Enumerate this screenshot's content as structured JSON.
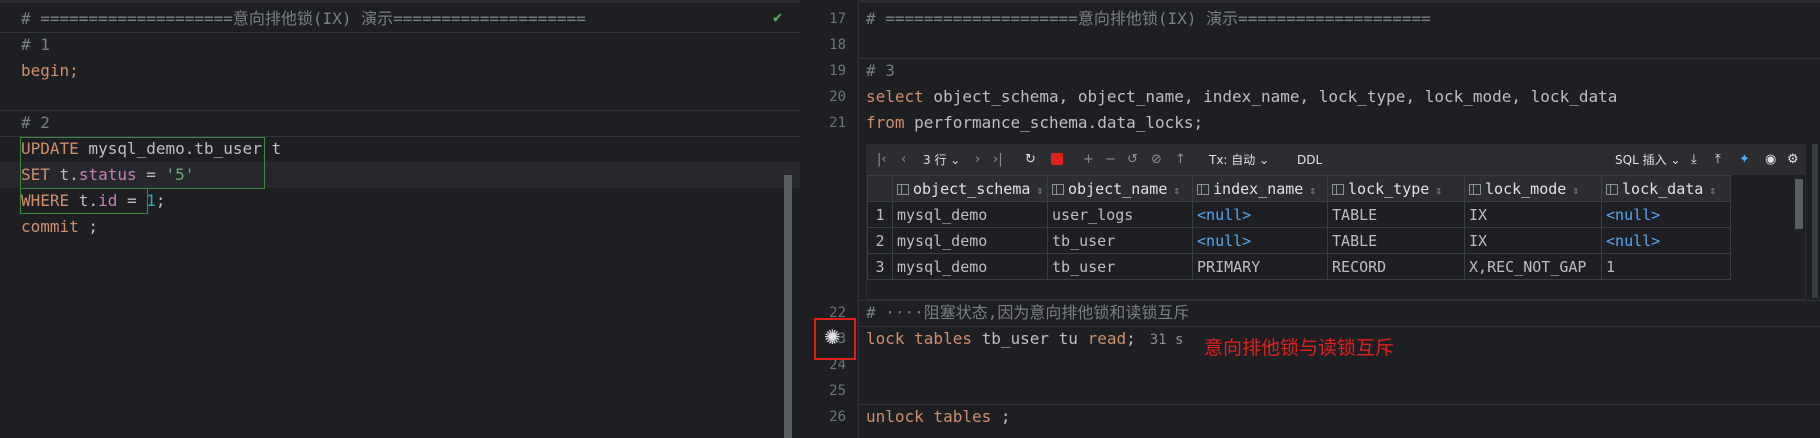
{
  "left": {
    "lines": {
      "l1": "# ====================意向排他锁(IX) 演示====================",
      "l2": "# 1",
      "l3": "begin;",
      "l5": "# 2",
      "l6_kw": "UPDATE",
      "l6_rest": " mysql_demo.tb_user t",
      "l7_kw": "SET",
      "l7_a": " t.",
      "l7_fld": "status",
      "l7_b": " = ",
      "l7_str": "'5'",
      "l8_kw": "WHERE",
      "l8_a": " t.",
      "l8_fld": "id",
      "l8_b": " = ",
      "l8_num": "1",
      "l8_c": ";",
      "l9_kw": "commit",
      "l9_rest": " ;"
    },
    "ok_icon": "check-icon",
    "close_icon": "×"
  },
  "right": {
    "line_numbers": {
      "n17": "17",
      "n18": "18",
      "n19": "19",
      "n20": "20",
      "n21": "21",
      "n22": "22",
      "n23": "23",
      "n24": "24",
      "n25": "25",
      "n26": "26"
    },
    "lines": {
      "l17": "# ====================意向排他锁(IX) 演示====================",
      "l19": "# 3",
      "l20_kw": "select",
      "l20_rest": " object_schema, object_name, index_name, lock_type, lock_mode, lock_data",
      "l21_kw": "from",
      "l21_rest": " performance_schema.data_locks;",
      "l22": "# ····阻塞状态,因为意向排他锁和读锁互斥",
      "l23_kw1": "lock",
      "l23_kw2": " tables",
      "l23_rest": " tb_user tu ",
      "l23_kw3": "read",
      "l23_semi": ";",
      "l23_elapsed": "31 s",
      "l26_kw1": "unlock",
      "l26_kw2": " tables",
      "l26_rest": " ;"
    },
    "annotation": "意向排他锁与读锁互斥",
    "toolbar": {
      "rows": "3 行",
      "tx": "Tx: 自动",
      "ddl": "DDL",
      "sql_insert": "SQL 插入"
    },
    "table": {
      "columns": [
        "object_schema",
        "object_name",
        "index_name",
        "lock_type",
        "lock_mode",
        "lock_data"
      ],
      "rows": [
        {
          "n": "1",
          "c": [
            "mysql_demo",
            "user_logs",
            "<null>",
            "TABLE",
            "IX",
            "<null>"
          ]
        },
        {
          "n": "2",
          "c": [
            "mysql_demo",
            "tb_user",
            "<null>",
            "TABLE",
            "IX",
            "<null>"
          ]
        },
        {
          "n": "3",
          "c": [
            "mysql_demo",
            "tb_user",
            "PRIMARY",
            "RECORD",
            "X,REC_NOT_GAP",
            "1"
          ]
        }
      ]
    }
  },
  "colors": {
    "background": "#1e1f22",
    "keyword": "#cf8e6d",
    "comment": "#7a7e85",
    "string": "#6aab73",
    "number": "#2aacb8",
    "null": "#56a8f5",
    "annotation": "#e0201c"
  }
}
